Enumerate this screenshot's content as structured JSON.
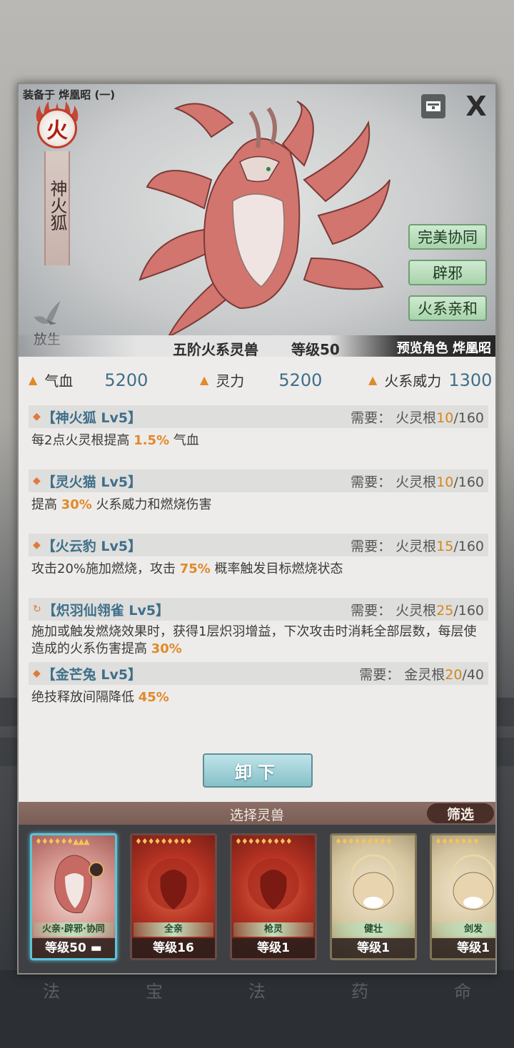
{
  "header": {
    "equip_label": "装备于 烨凰昭 (一)",
    "element_badge": "火",
    "beast_name": "神火狐",
    "close_label": "X"
  },
  "hero": {
    "skill_tags": [
      "完美协同",
      "辟邪",
      "火系亲和"
    ],
    "release_label": "放生",
    "tier": "五阶火系灵兽",
    "level": "等级50",
    "preview": "预览角色 烨凰昭"
  },
  "stats": [
    {
      "label": "气血",
      "value": "5200"
    },
    {
      "label": "灵力",
      "value": "5200"
    },
    {
      "label": "火系威力",
      "value": "1300"
    }
  ],
  "skills": [
    {
      "icon": "diamond-icon",
      "title": "【神火狐 Lv5】",
      "req_prefix": "需要：  火灵根",
      "req_have": "10",
      "req_total": "/160",
      "desc_a": "每2点火灵根提高 ",
      "desc_hl": "1.5%",
      "desc_b": " 气血"
    },
    {
      "icon": "diamond-icon",
      "title": "【灵火猫 Lv5】",
      "req_prefix": "需要：  火灵根",
      "req_have": "10",
      "req_total": "/160",
      "desc_a": "提高 ",
      "desc_hl": "30%",
      "desc_b": " 火系威力和燃烧伤害"
    },
    {
      "icon": "diamond-icon",
      "title": "【火云豹 Lv5】",
      "req_prefix": "需要：  火灵根",
      "req_have": "15",
      "req_total": "/160",
      "desc_a": "攻击20%施加燃烧，攻击 ",
      "desc_hl": "75%",
      "desc_b": " 概率触发目标燃烧状态"
    },
    {
      "icon": "cycle-icon",
      "title": "【炽羽仙翎雀 Lv5】",
      "req_prefix": "需要：  火灵根",
      "req_have": "25",
      "req_total": "/160",
      "desc_a": "施加或触发燃烧效果时，获得1层炽羽增益，下次攻击时消耗全部层数，每层使造成的火系伤害提高 ",
      "desc_hl": "30%",
      "desc_b": ""
    },
    {
      "icon": "diamond-icon",
      "title": "【金芒兔 Lv5】",
      "req_prefix": "需要：  金灵根",
      "req_have": "20",
      "req_total": "/40",
      "desc_a": "绝技释放间隔降低 ",
      "desc_hl": "45%",
      "desc_b": ""
    }
  ],
  "unequip_label": "卸下",
  "selector": {
    "title": "选择灵兽",
    "filter_label": "筛选",
    "cards": [
      {
        "trait": "火亲·辟邪·协同",
        "level": "等级50",
        "style": "pink",
        "selected": true
      },
      {
        "trait": "全亲",
        "level": "等级16",
        "style": "red",
        "selected": false
      },
      {
        "trait": "枪灵",
        "level": "等级1",
        "style": "red",
        "selected": false
      },
      {
        "trait": "健壮",
        "level": "等级1",
        "style": "tan",
        "selected": false
      },
      {
        "trait": "剑发",
        "level": "等级1",
        "style": "tan",
        "selected": false
      }
    ]
  },
  "background_nav": [
    "法",
    "宝",
    "法",
    "药",
    "命"
  ],
  "colors": {
    "accent_orange": "#e0892a",
    "stat_blue": "#3f6f8a",
    "tag_green": "#a8d3ab",
    "button_teal": "#86c0c9"
  }
}
